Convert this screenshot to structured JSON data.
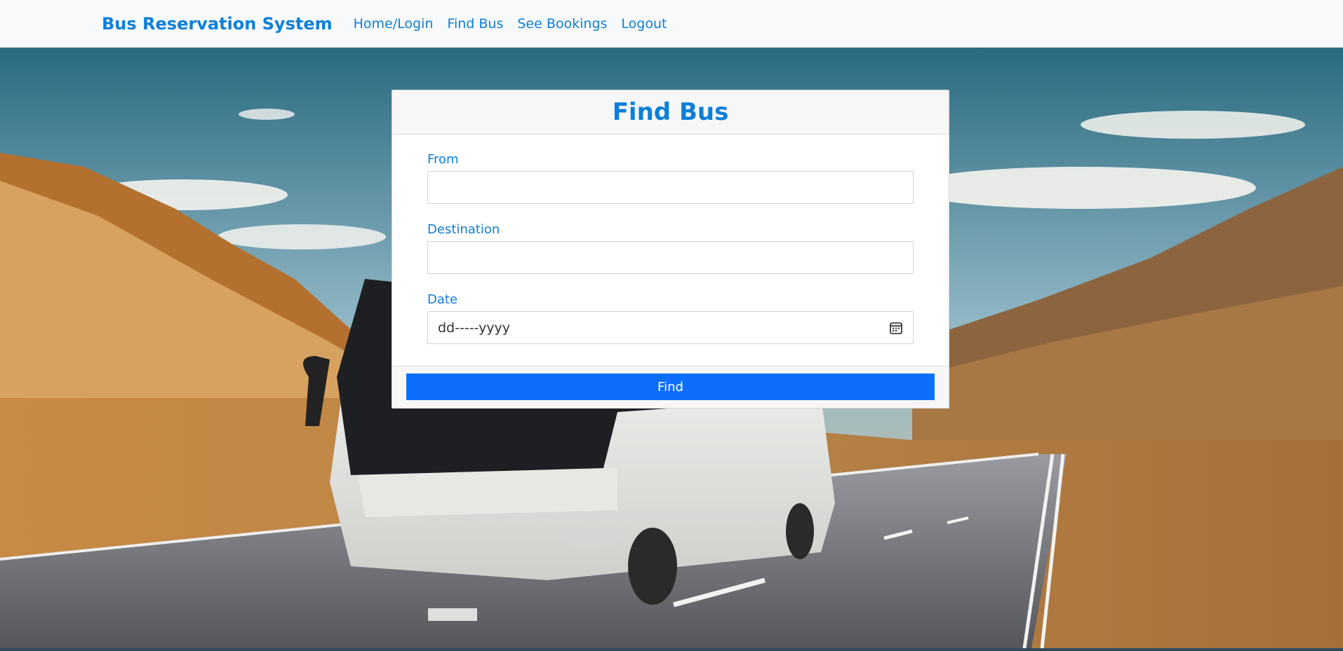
{
  "app": {
    "brand": "Bus Reservation System"
  },
  "nav": {
    "items": [
      {
        "label": "Home/Login"
      },
      {
        "label": "Find Bus"
      },
      {
        "label": "See Bookings"
      },
      {
        "label": "Logout"
      }
    ]
  },
  "form": {
    "title": "Find Bus",
    "from": {
      "label": "From",
      "value": "",
      "placeholder": ""
    },
    "destination": {
      "label": "Destination",
      "value": "",
      "placeholder": ""
    },
    "date": {
      "label": "Date",
      "value": "dd-----yyyy"
    },
    "submit_label": "Find"
  },
  "colors": {
    "accent": "#0d7fd8",
    "button": "#0d6efd",
    "navbar_bg": "#f8f9fa"
  },
  "icons": {
    "date": "calendar-icon"
  },
  "background": {
    "image": "bus-on-desert-highway-photo"
  }
}
